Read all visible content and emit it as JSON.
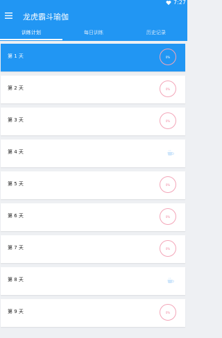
{
  "status_bar": {
    "time": "7:27"
  },
  "toolbar": {
    "title": "龙虎霸斗瑜伽"
  },
  "tabs": [
    {
      "label": "训练计划",
      "active": true
    },
    {
      "label": "每日训练",
      "active": false
    },
    {
      "label": "历史记录",
      "active": false
    }
  ],
  "days": [
    {
      "label": "第 1 天",
      "progress": "0%",
      "type": "training",
      "active": true
    },
    {
      "label": "第 2 天",
      "progress": "0%",
      "type": "training",
      "active": false
    },
    {
      "label": "第 3 天",
      "progress": "0%",
      "type": "training",
      "active": false
    },
    {
      "label": "第 4 天",
      "progress": "",
      "type": "rest",
      "active": false
    },
    {
      "label": "第 5 天",
      "progress": "0%",
      "type": "training",
      "active": false
    },
    {
      "label": "第 6 天",
      "progress": "0%",
      "type": "training",
      "active": false
    },
    {
      "label": "第 7 天",
      "progress": "0%",
      "type": "training",
      "active": false
    },
    {
      "label": "第 8 天",
      "progress": "",
      "type": "rest",
      "active": false
    },
    {
      "label": "第 9 天",
      "progress": "0%",
      "type": "training",
      "active": false
    }
  ],
  "colors": {
    "primary": "#2196f3",
    "ring": "#f3a5b8",
    "background": "#eef0f3"
  },
  "icons": {
    "menu": "menu-icon",
    "status": "heart-icon",
    "rest": "teacup-icon"
  }
}
